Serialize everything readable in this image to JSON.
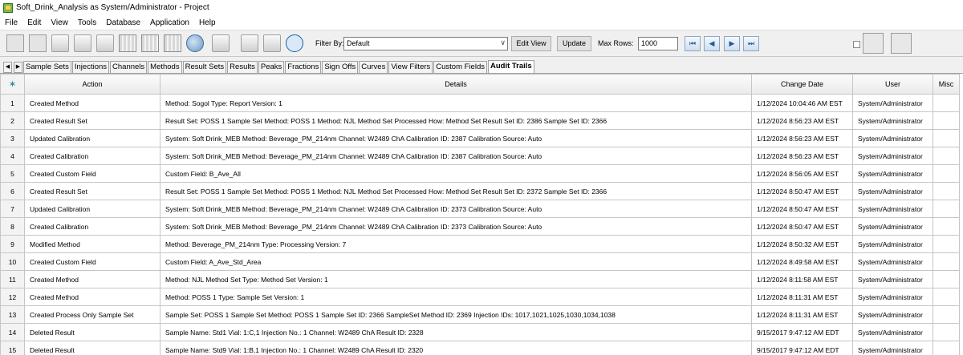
{
  "window": {
    "title": "Soft_Drink_Analysis as System/Administrator - Project"
  },
  "menu": [
    "File",
    "Edit",
    "View",
    "Tools",
    "Database",
    "Application",
    "Help"
  ],
  "toolbar": {
    "filter_label": "Filter By:",
    "filter_value": "Default",
    "edit_view": "Edit View",
    "update": "Update",
    "max_rows_label": "Max Rows:",
    "max_rows_value": "1000",
    "nav": [
      "⏮",
      "◀",
      "▶",
      "⏭"
    ]
  },
  "tabs": [
    "Sample Sets",
    "Injections",
    "Channels",
    "Methods",
    "Result Sets",
    "Results",
    "Peaks",
    "Fractions",
    "Sign Offs",
    "Curves",
    "View Filters",
    "Custom Fields",
    "Audit Trails"
  ],
  "active_tab": "Audit Trails",
  "columns": [
    "",
    "Action",
    "Details",
    "Change Date",
    "User",
    "Misc"
  ],
  "rows": [
    {
      "n": "1",
      "action": "Created Method",
      "details": "Method: Sogol   Type: Report   Version: 1",
      "date": "1/12/2024 10:04:46 AM EST",
      "user": "System/Administrator"
    },
    {
      "n": "2",
      "action": "Created Result Set",
      "details": "Result Set: POSS 1   Sample Set Method: POSS 1   Method: NJL Method Set   Processed How: Method Set      Result Set ID: 2386   Sample Set ID: 2366",
      "date": "1/12/2024 8:56:23 AM EST",
      "user": "System/Administrator"
    },
    {
      "n": "3",
      "action": "Updated Calibration",
      "details": "System: Soft Drink_MEB   Method: Beverage_PM_214nm   Channel: W2489 ChA   Calibration ID: 2387   Calibration Source: Auto",
      "date": "1/12/2024 8:56:23 AM EST",
      "user": "System/Administrator"
    },
    {
      "n": "4",
      "action": "Created Calibration",
      "details": "System: Soft Drink_MEB   Method: Beverage_PM_214nm   Channel: W2489 ChA   Calibration ID: 2387   Calibration Source: Auto",
      "date": "1/12/2024 8:56:23 AM EST",
      "user": "System/Administrator"
    },
    {
      "n": "5",
      "action": "Created Custom Field",
      "details": "Custom Field: B_Ave_All",
      "date": "1/12/2024 8:56:05 AM EST",
      "user": "System/Administrator"
    },
    {
      "n": "6",
      "action": "Created Result Set",
      "details": "Result Set: POSS 1   Sample Set Method: POSS 1   Method: NJL Method Set   Processed How: Method Set      Result Set ID: 2372   Sample Set ID: 2366",
      "date": "1/12/2024 8:50:47 AM EST",
      "user": "System/Administrator"
    },
    {
      "n": "7",
      "action": "Updated Calibration",
      "details": "System: Soft Drink_MEB   Method: Beverage_PM_214nm   Channel: W2489 ChA   Calibration ID: 2373   Calibration Source: Auto",
      "date": "1/12/2024 8:50:47 AM EST",
      "user": "System/Administrator"
    },
    {
      "n": "8",
      "action": "Created Calibration",
      "details": "System: Soft Drink_MEB   Method: Beverage_PM_214nm   Channel: W2489 ChA   Calibration ID: 2373   Calibration Source: Auto",
      "date": "1/12/2024 8:50:47 AM EST",
      "user": "System/Administrator"
    },
    {
      "n": "9",
      "action": "Modified Method",
      "details": "Method: Beverage_PM_214nm   Type: Processing   Version: 7",
      "date": "1/12/2024 8:50:32 AM EST",
      "user": "System/Administrator"
    },
    {
      "n": "10",
      "action": "Created Custom Field",
      "details": "Custom Field: A_Ave_Std_Area",
      "date": "1/12/2024 8:49:58 AM EST",
      "user": "System/Administrator"
    },
    {
      "n": "11",
      "action": "Created Method",
      "details": "Method: NJL Method Set   Type: Method Set   Version: 1",
      "date": "1/12/2024 8:11:58 AM EST",
      "user": "System/Administrator"
    },
    {
      "n": "12",
      "action": "Created Method",
      "details": "Method: POSS 1   Type: Sample Set   Version: 1",
      "date": "1/12/2024 8:11:31 AM EST",
      "user": "System/Administrator"
    },
    {
      "n": "13",
      "action": "Created Process Only Sample Set",
      "details": "Sample Set: POSS 1   Sample Set Method: POSS 1   Sample Set ID: 2366   SampleSet Method ID: 2369   Injection IDs: 1017,1021,1025,1030,1034,1038",
      "date": "1/12/2024 8:11:31 AM EST",
      "user": "System/Administrator"
    },
    {
      "n": "14",
      "action": "Deleted Result",
      "details": "Sample Name: Std1   Vial: 1:C,1   Injection No.: 1   Channel: W2489 ChA   Result ID: 2328",
      "date": "9/15/2017 9:47:12 AM EDT",
      "user": "System/Administrator"
    },
    {
      "n": "15",
      "action": "Deleted Result",
      "details": "Sample Name: Std9   Vial: 1:B,1   Injection No.: 1   Channel: W2489 ChA   Result ID: 2320",
      "date": "9/15/2017 9:47:12 AM EDT",
      "user": "System/Administrator"
    }
  ]
}
